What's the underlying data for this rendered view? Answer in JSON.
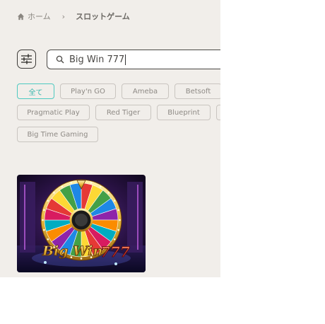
{
  "breadcrumb": {
    "home": "ホーム",
    "current": "スロットゲーム"
  },
  "search": {
    "value": "Big Win 777"
  },
  "filters": [
    {
      "label": "全て",
      "active": true
    },
    {
      "label": "Play'n GO",
      "active": false
    },
    {
      "label": "Ameba",
      "active": false
    },
    {
      "label": "Betsoft",
      "active": false
    },
    {
      "label": "Pragmatic Play",
      "active": false
    },
    {
      "label": "Red Tiger",
      "active": false
    },
    {
      "label": "Blueprint",
      "active": false
    },
    {
      "label": "Big Time Gaming",
      "active": false
    }
  ],
  "game": {
    "logo_text": "Big Win 777"
  },
  "colors": {
    "accent": "#4ec9c0",
    "panel_bg": "#f1eeea"
  }
}
